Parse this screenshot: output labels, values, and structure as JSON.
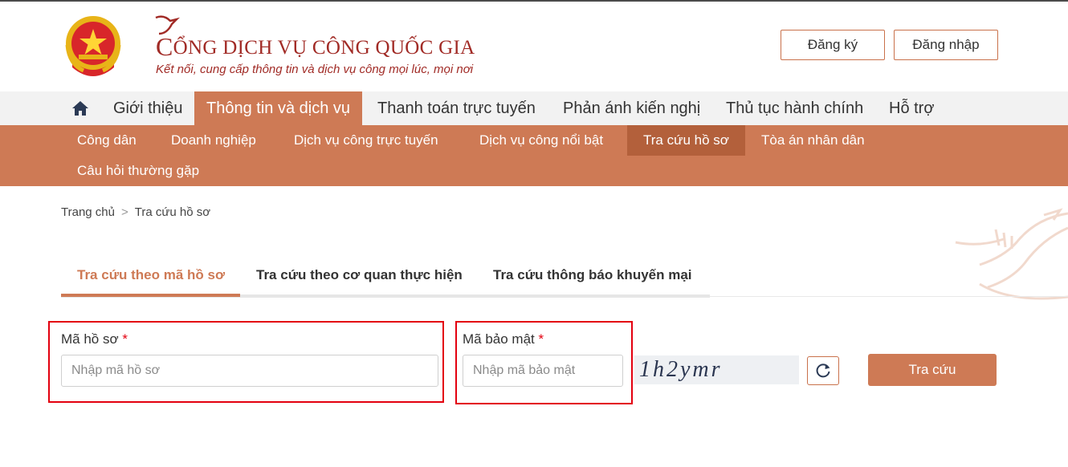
{
  "header": {
    "title_first_letter": "C",
    "title_rest": "ỔNG DỊCH VỤ CÔNG QUỐC GIA",
    "slogan": "Kết nối, cung cấp thông tin và dịch vụ công mọi lúc, mọi nơi",
    "register_label": "Đăng ký",
    "login_label": "Đăng nhập",
    "emblem_icon": "national-emblem-icon"
  },
  "mainnav": {
    "home_icon": "home-icon",
    "items": [
      {
        "label": "Giới thiệu"
      },
      {
        "label": "Thông tin và dịch vụ"
      },
      {
        "label": "Thanh toán trực tuyến"
      },
      {
        "label": "Phản ánh kiến nghị"
      },
      {
        "label": "Thủ tục hành chính"
      },
      {
        "label": "Hỗ trợ"
      }
    ],
    "active_index": 1
  },
  "subnav": {
    "items": [
      {
        "label": "Công dân"
      },
      {
        "label": "Doanh nghiệp"
      },
      {
        "label": "Dịch vụ công trực tuyến"
      },
      {
        "label": "Dịch vụ công nổi bật"
      },
      {
        "label": "Tra cứu hồ sơ"
      },
      {
        "label": "Tòa án nhân dân"
      },
      {
        "label": "Câu hỏi thường gặp"
      }
    ],
    "active_index": 4
  },
  "breadcrumb": {
    "home": "Trang chủ",
    "separator": ">",
    "current": "Tra cứu hồ sơ"
  },
  "tabs": [
    {
      "label": "Tra cứu theo mã hồ sơ"
    },
    {
      "label": "Tra cứu theo cơ quan thực hiện"
    },
    {
      "label": "Tra cứu thông báo khuyến mại"
    }
  ],
  "form": {
    "record_code": {
      "label": "Mã hồ sơ",
      "required_mark": "*",
      "placeholder": "Nhập mã hồ sơ",
      "value": ""
    },
    "security_code": {
      "label": "Mã bảo mật",
      "required_mark": "*",
      "placeholder": "Nhập mã bảo mật",
      "value": ""
    },
    "captcha_text": "1h2ymr",
    "refresh_icon": "refresh-icon",
    "submit_label": "Tra cứu"
  },
  "colors": {
    "brand": "#ce7a55",
    "brand_dark": "#b3603b",
    "title_red": "#a12b26",
    "highlight_red": "#e3000f"
  }
}
